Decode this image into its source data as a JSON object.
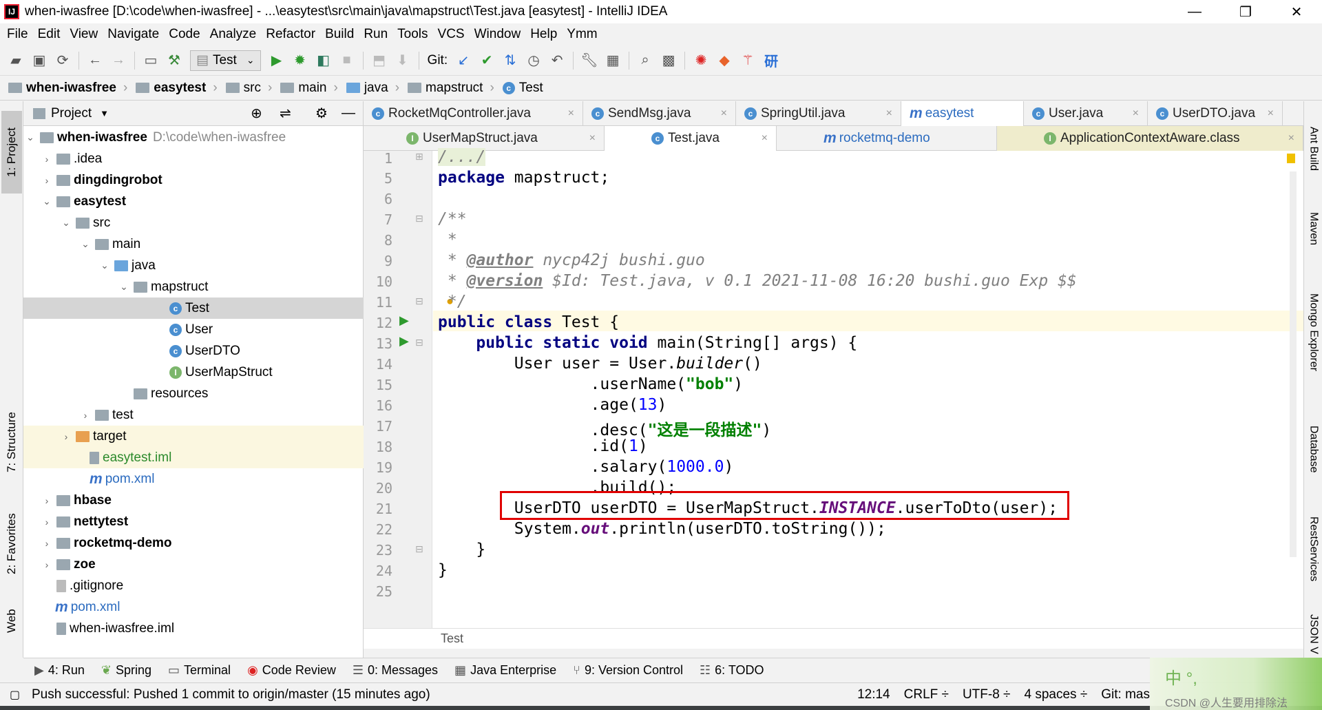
{
  "window": {
    "title": "when-iwasfree [D:\\code\\when-iwasfree] - ...\\easytest\\src\\main\\java\\mapstruct\\Test.java [easytest] - IntelliJ IDEA",
    "controls": [
      "—",
      "❐",
      "✕"
    ]
  },
  "menu": [
    "File",
    "Edit",
    "View",
    "Navigate",
    "Code",
    "Analyze",
    "Refactor",
    "Build",
    "Run",
    "Tools",
    "VCS",
    "Window",
    "Help",
    "Ymm"
  ],
  "toolbar": {
    "run_config": "Test",
    "git_label": "Git:"
  },
  "breadcrumb": [
    "when-iwasfree",
    "easytest",
    "src",
    "main",
    "java",
    "mapstruct",
    "Test"
  ],
  "left_strip": {
    "project": "1: Project",
    "structure": "7: Structure",
    "favorites": "2: Favorites",
    "web": "Web"
  },
  "right_strip": {
    "ant": "Ant Build",
    "maven": "Maven",
    "mongo": "Mongo Explorer",
    "database": "Database",
    "rest": "RestServices",
    "json": "JSON V"
  },
  "project_panel": {
    "title": "Project",
    "tree": [
      {
        "label": "when-iwasfree",
        "path": "D:\\code\\when-iwasfree"
      },
      {
        "label": ".idea"
      },
      {
        "label": "dingdingrobot"
      },
      {
        "label": "easytest"
      },
      {
        "label": "src"
      },
      {
        "label": "main"
      },
      {
        "label": "java"
      },
      {
        "label": "mapstruct"
      },
      {
        "label": "Test"
      },
      {
        "label": "User"
      },
      {
        "label": "UserDTO"
      },
      {
        "label": "UserMapStruct"
      },
      {
        "label": "resources"
      },
      {
        "label": "test"
      },
      {
        "label": "target"
      },
      {
        "label": "easytest.iml"
      },
      {
        "label": "pom.xml"
      },
      {
        "label": "hbase"
      },
      {
        "label": "nettytest"
      },
      {
        "label": "rocketmq-demo"
      },
      {
        "label": "zoe"
      },
      {
        "label": ".gitignore"
      },
      {
        "label": "pom.xml"
      },
      {
        "label": "when-iwasfree.iml"
      }
    ]
  },
  "editor_tabs_row1": [
    "RocketMqController.java",
    "SendMsg.java",
    "SpringUtil.java",
    "easytest",
    "User.java",
    "UserDTO.java"
  ],
  "editor_tabs_row2": [
    "UserMapStruct.java",
    "Test.java",
    "rocketmq-demo",
    "ApplicationContextAware.class"
  ],
  "code": {
    "line_numbers": [
      "1",
      "5",
      "6",
      "7",
      "8",
      "9",
      "10",
      "11",
      "12",
      "13",
      "14",
      "15",
      "16",
      "17",
      "18",
      "19",
      "20",
      "21",
      "22",
      "23",
      "24",
      "25"
    ],
    "l1": "/.../",
    "l5_kw": "package",
    "l5_rest": " mapstruct;",
    "l7": "/**",
    "l8": " *",
    "l9_star": " * ",
    "l9_tag": "@author",
    "l9_rest": " nycp42j bushi.guo",
    "l10_star": " * ",
    "l10_tag": "@version",
    "l10_rest": " $Id: Test.java, v 0.1 2021-11-08 16:20 bushi.guo Exp $$",
    "l11": " */",
    "l12_kw": "public class",
    "l12_rest": " Test {",
    "l13_kw": "    public static void",
    "l13_rest": " main(String[] args) {",
    "l14_a": "        User user = User.",
    "l14_m": "builder",
    "l14_b": "()",
    "l15_a": "                .userName(",
    "l15_s": "\"bob\"",
    "l15_b": ")",
    "l16_a": "                .age(",
    "l16_n": "13",
    "l16_b": ")",
    "l17_a": "                .desc(",
    "l17_s": "\"这是一段描述\"",
    "l17_b": ")",
    "l18_a": "                .id(",
    "l18_n": "1",
    "l18_b": ")",
    "l19_a": "                .salary(",
    "l19_n": "1000.0",
    "l19_b": ")",
    "l20": "                .build();",
    "l21_a": "        UserDTO userDTO = UserMapStruct.",
    "l21_s": "INSTANCE",
    "l21_b": ".userToDto(user);",
    "l22_a": "        System.",
    "l22_s": "out",
    "l22_b": ".println(userDTO.toString());",
    "l23": "    }",
    "l24": "}",
    "l25": ""
  },
  "editor_breadcrumb": "Test",
  "bottom_tabs": [
    "4: Run",
    "Spring",
    "Terminal",
    "Code Review",
    "0: Messages",
    "Java Enterprise",
    "9: Version Control",
    "6: TODO"
  ],
  "status": {
    "message": "Push successful: Pushed 1 commit to origin/master (15 minutes ago)",
    "position": "12:14",
    "line_sep": "CRLF ÷",
    "encoding": "UTF-8 ÷",
    "indent": "4 spaces ÷",
    "git": "Git: mas"
  },
  "watermark": {
    "text": "CSDN @人生要用排除法",
    "char": "中 °, "
  }
}
